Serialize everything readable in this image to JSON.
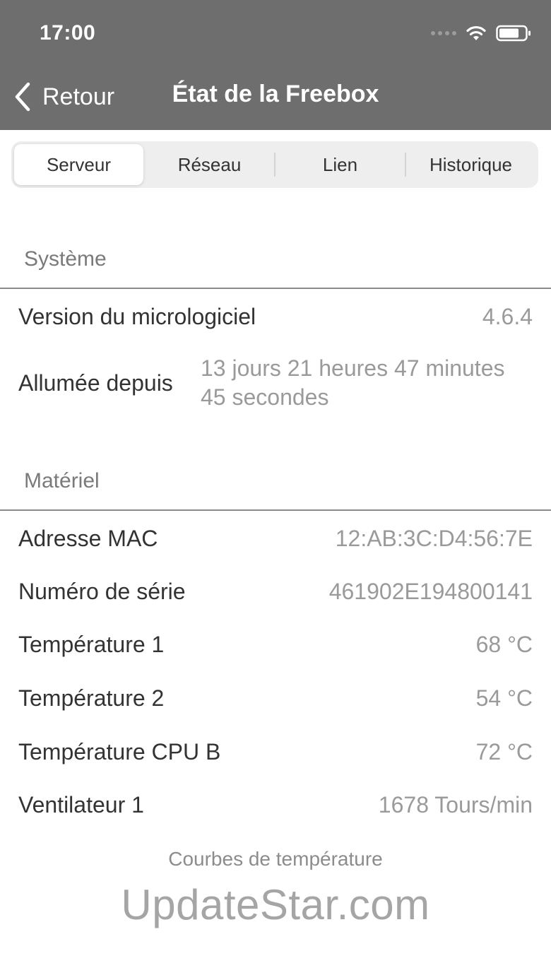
{
  "status_bar": {
    "time": "17:00"
  },
  "nav": {
    "back_label": "Retour",
    "title": "État de la Freebox"
  },
  "tabs": [
    {
      "label": "Serveur",
      "active": true
    },
    {
      "label": "Réseau",
      "active": false
    },
    {
      "label": "Lien",
      "active": false
    },
    {
      "label": "Historique",
      "active": false
    }
  ],
  "system": {
    "header": "Système",
    "firmware": {
      "label": "Version du micrologiciel",
      "value": "4.6.4"
    },
    "uptime": {
      "label": "Allumée depuis",
      "value": "13 jours 21 heures 47 minutes 45 secondes"
    }
  },
  "hardware": {
    "header": "Matériel",
    "mac": {
      "label": "Adresse MAC",
      "value": "12:AB:3C:D4:56:7E"
    },
    "serial": {
      "label": "Numéro de série",
      "value": "461902E194800141"
    },
    "temp1": {
      "label": "Température 1",
      "value": "68 °C"
    },
    "temp2": {
      "label": "Température 2",
      "value": "54 °C"
    },
    "temp_cpu_b": {
      "label": "Température CPU B",
      "value": "72 °C"
    },
    "fan1": {
      "label": "Ventilateur 1",
      "value": "1678 Tours/min"
    }
  },
  "footer": {
    "link": "Courbes de température"
  },
  "watermark": "UpdateStar.com",
  "colors": {
    "header_bg": "#6e6e6e",
    "value_text": "#9a9a9a"
  }
}
